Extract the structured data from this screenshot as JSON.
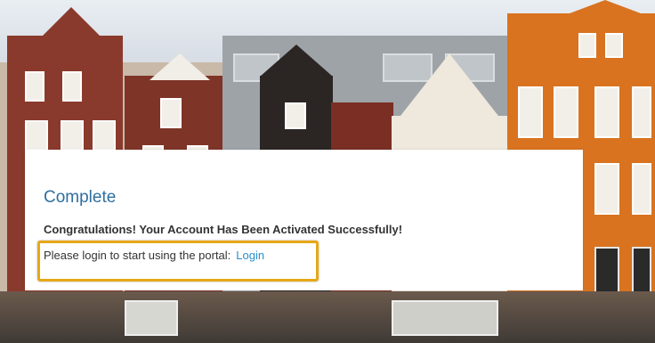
{
  "card": {
    "title": "Complete",
    "message": "Congratulations! Your Account Has Been Activated Successfully!",
    "login_prompt": "Please login to start using the portal:",
    "login_link": "Login"
  },
  "colors": {
    "title": "#2f6f9f",
    "link": "#2a8fd0",
    "highlight": "#e6a817"
  }
}
